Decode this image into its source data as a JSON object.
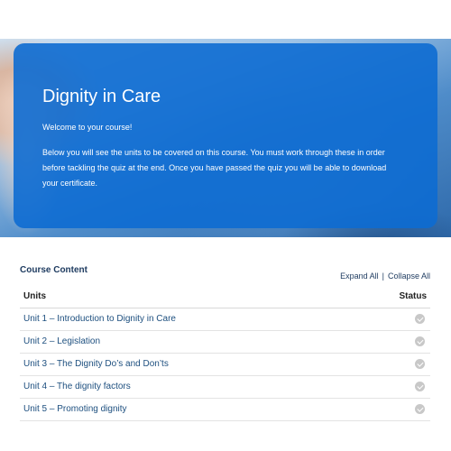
{
  "hero": {
    "title": "Dignity in Care",
    "welcome": "Welcome to your course!",
    "body": "Below you will see the units to be covered on this course. You must work through these in order before tackling the quiz at the end. Once you have passed the quiz you will be able to download your certificate."
  },
  "course_content": {
    "title": "Course Content",
    "expand_all": "Expand All",
    "separator": "|",
    "collapse_all": "Collapse All",
    "columns": {
      "units": "Units",
      "status": "Status"
    },
    "units": [
      {
        "label": "Unit 1 – Introduction to Dignity in Care",
        "status_icon": "check-circle-icon"
      },
      {
        "label": "Unit 2 – Legislation",
        "status_icon": "check-circle-icon"
      },
      {
        "label": "Unit 3 – The Dignity Do’s and Don’ts",
        "status_icon": "check-circle-icon"
      },
      {
        "label": "Unit 4 – The dignity factors",
        "status_icon": "check-circle-icon"
      },
      {
        "label": "Unit 5 – Promoting dignity",
        "status_icon": "check-circle-icon"
      }
    ]
  },
  "colors": {
    "card_blue": "#0d6cd1",
    "link_blue": "#1d4f7f",
    "status_grey": "#c8c8c8"
  }
}
